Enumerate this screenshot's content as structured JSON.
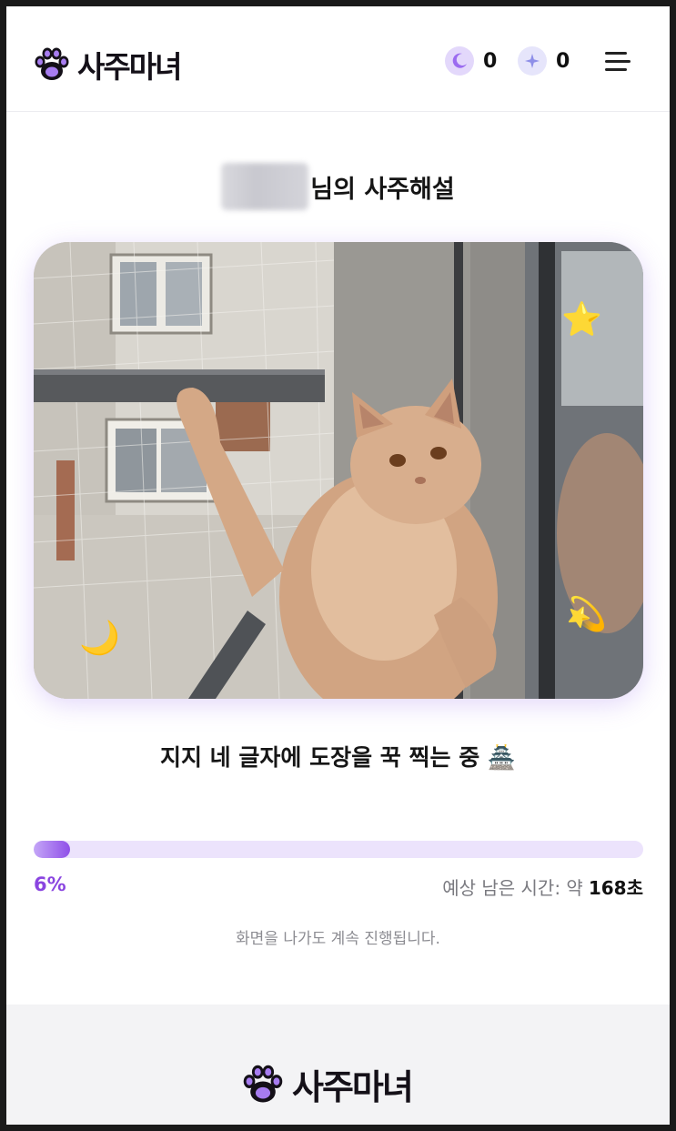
{
  "header": {
    "logo_text": "사주마녀",
    "moon_count": "0",
    "star_count": "0",
    "menu_icon": "hamburger-menu-icon"
  },
  "main": {
    "title_suffix": "님의 사주해설",
    "status_text": "지지 네 글자에 도장을 꾹 찍는 중 🏯",
    "image_stickers": {
      "moon": "🌙",
      "star": "⭐",
      "star_ring": "💫"
    }
  },
  "progress": {
    "percent_label": "6%",
    "percent_value": 0.06,
    "eta_label": "예상 남은 시간: 약",
    "eta_value": "168초",
    "note": "화면을 나가도 계속 진행됩니다."
  },
  "footer": {
    "logo_text": "사주마녀"
  },
  "colors": {
    "accent": "#8a45e0",
    "progress_track": "#ece3fc",
    "footer_bg": "#f3f3f5"
  }
}
